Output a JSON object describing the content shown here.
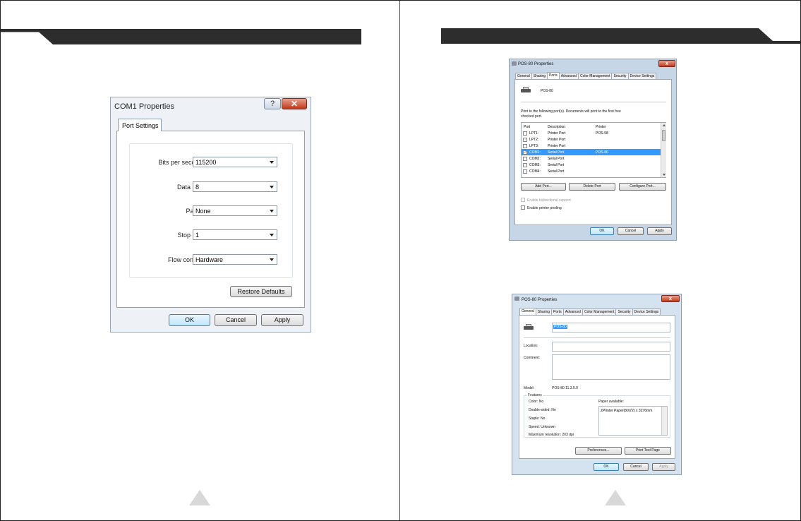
{
  "com1_dialog": {
    "title": "COM1 Properties",
    "help_label": "?",
    "close_label": "✕",
    "tab_label": "Port Settings",
    "fields": [
      {
        "label": "Bits per second:",
        "value": "115200"
      },
      {
        "label": "Data bits:",
        "value": "8"
      },
      {
        "label": "Parity:",
        "value": "None"
      },
      {
        "label": "Stop bits:",
        "value": "1"
      },
      {
        "label": "Flow control:",
        "value": "Hardware"
      }
    ],
    "restore_label": "Restore Defaults",
    "ok_label": "OK",
    "cancel_label": "Cancel",
    "apply_label": "Apply"
  },
  "ports_dialog": {
    "title": "POS-80 Properties",
    "close_label": "x",
    "tabs": [
      "General",
      "Sharing",
      "Ports",
      "Advanced",
      "Color Management",
      "Security",
      "Device Settings"
    ],
    "active_tab": "Ports",
    "printer_name": "POS-80",
    "instruction_line1": "Print to the following port(s). Documents will print to the first free",
    "instruction_line2": "checked port.",
    "columns": [
      "Port",
      "Description",
      "Printer"
    ],
    "rows": [
      {
        "port": "LPT1:",
        "description": "Printer Port",
        "printer": "POS-58",
        "checked": false
      },
      {
        "port": "LPT2:",
        "description": "Printer Port",
        "printer": "",
        "checked": false
      },
      {
        "port": "LPT3:",
        "description": "Printer Port",
        "printer": "",
        "checked": false
      },
      {
        "port": "COM1:",
        "description": "Serial Port",
        "printer": "POS-80",
        "checked": true
      },
      {
        "port": "COM2:",
        "description": "Serial Port",
        "printer": "",
        "checked": false
      },
      {
        "port": "COM3:",
        "description": "Serial Port",
        "printer": "",
        "checked": false
      },
      {
        "port": "COM4:",
        "description": "Serial Port",
        "printer": "",
        "checked": false
      }
    ],
    "add_port_label": "Add Port...",
    "delete_port_label": "Delete Port",
    "configure_port_label": "Configure Port...",
    "bidirectional_label": "Enable bidirectional support",
    "pooling_label": "Enable printer pooling",
    "ok_label": "OK",
    "cancel_label": "Cancel",
    "apply_label": "Apply"
  },
  "general_dialog": {
    "title": "POS-80 Properties",
    "close_label": "x",
    "tabs": [
      "General",
      "Sharing",
      "Ports",
      "Advanced",
      "Color Management",
      "Security",
      "Device Settings"
    ],
    "active_tab": "General",
    "printer_name": "POS-80",
    "location_label": "Location:",
    "comment_label": "Comment:",
    "model_label": "Model:",
    "model_value": "POS-80 11.3.0.0",
    "features_label": "Features",
    "color": "Color: No",
    "double_sided": "Double-sided: No",
    "staple": "Staple: No",
    "speed": "Speed: Unknown",
    "resolution": "Maximum resolution: 203 dpi",
    "paper_available_label": "Paper available:",
    "paper_item": "ZPrinter Paper(80(72) x 3276mm",
    "preferences_label": "Preferences...",
    "print_test_label": "Print Test Page",
    "ok_label": "OK",
    "cancel_label": "Cancel",
    "apply_label": "Apply"
  }
}
